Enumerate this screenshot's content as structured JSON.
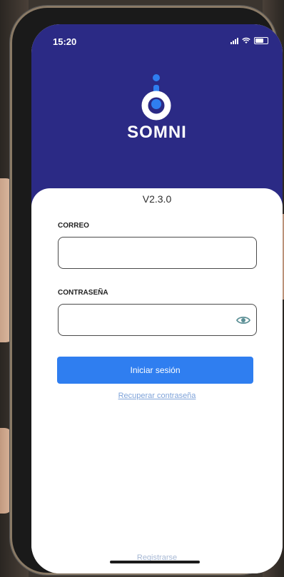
{
  "status_bar": {
    "time": "15:20"
  },
  "app": {
    "brand": "SOMNI",
    "version": "V2.3.0"
  },
  "login": {
    "email_label": "CORREO",
    "email_value": "",
    "password_label": "CONTRASEÑA",
    "password_value": "",
    "submit_label": "Iniciar sesión",
    "recover_link": "Recuperar contraseña",
    "register_link": "Registrarse"
  },
  "colors": {
    "header": "#2b2a85",
    "primary_button": "#2f7ef0",
    "logo": "#2f7ef0",
    "link": "#7fa3d9"
  },
  "icons": [
    "signal-icon",
    "wifi-icon",
    "battery-icon",
    "somni-logo-icon",
    "eye-icon"
  ]
}
